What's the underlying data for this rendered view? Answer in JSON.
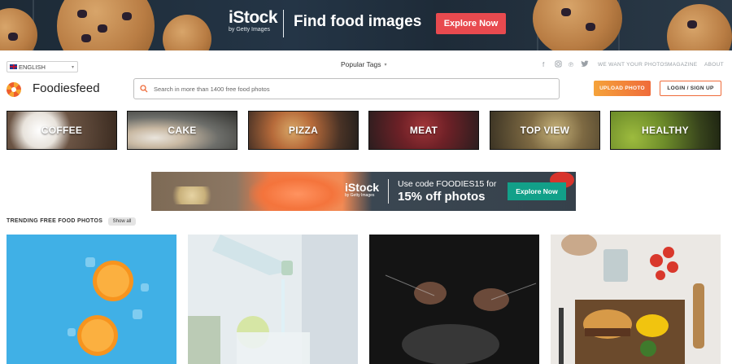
{
  "top_banner": {
    "brand": "iStock",
    "brand_sub": "by Getty Images",
    "headline": "Find food images",
    "cta": "Explore Now"
  },
  "utility": {
    "language": "ENGLISH",
    "popular_tags": "Popular Tags",
    "social_icons": [
      "facebook-icon",
      "instagram-icon",
      "pinterest-icon",
      "twitter-icon"
    ],
    "links": [
      "WE WANT YOUR PHOTOS",
      "MAGAZINE",
      "ABOUT"
    ]
  },
  "header": {
    "logo_text": "Foodiesfeed",
    "search_placeholder": "Search in more than 1400 free food photos",
    "upload_label": "UPLOAD PHOTO",
    "login_label": "LOGIN / SIGN UP"
  },
  "categories": [
    {
      "label": "COFFEE"
    },
    {
      "label": "CAKE"
    },
    {
      "label": "PIZZA"
    },
    {
      "label": "MEAT"
    },
    {
      "label": "TOP VIEW"
    },
    {
      "label": "HEALTHY"
    }
  ],
  "mid_banner": {
    "brand": "iStock",
    "brand_sub": "by Getty Images",
    "code_text": "Use code FOODIES15 for",
    "offer_text": "15% off photos",
    "cta": "Explore Now"
  },
  "trending": {
    "title": "TRENDING FREE FOOD PHOTOS",
    "show_all": "Show all"
  },
  "colors": {
    "accent_red": "#e84a4f",
    "upload_gradient_start": "#f5a33a",
    "upload_gradient_end": "#ef6b3a",
    "teal_cta": "#12a089"
  }
}
